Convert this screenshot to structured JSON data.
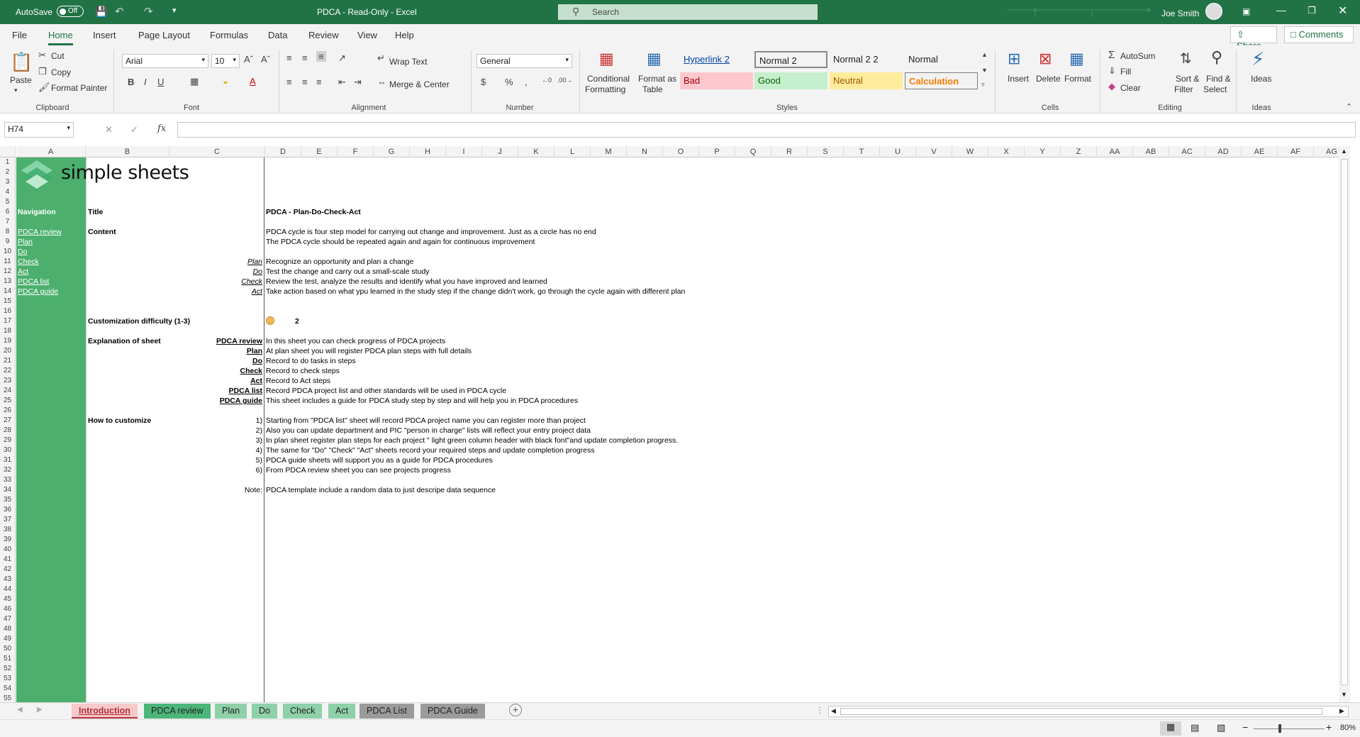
{
  "titlebar": {
    "autosave": "AutoSave",
    "toggle": "Off",
    "title": "PDCA  -  Read-Only  -  Excel",
    "search": "Search",
    "user": "Joe Smith"
  },
  "menu": {
    "tabs": [
      "File",
      "Home",
      "Insert",
      "Page Layout",
      "Formulas",
      "Data",
      "Review",
      "View",
      "Help"
    ],
    "share": "Share",
    "comments": "Comments"
  },
  "ribbon": {
    "clipboard": {
      "paste": "Paste",
      "cut": "Cut",
      "copy": "Copy",
      "format_painter": "Format Painter",
      "group": "Clipboard"
    },
    "font": {
      "name": "Arial",
      "size": "10",
      "group": "Font"
    },
    "alignment": {
      "wrap": "Wrap Text",
      "merge": "Merge & Center",
      "group": "Alignment"
    },
    "number": {
      "format": "General",
      "group": "Number"
    },
    "styles": {
      "cond": "Conditional",
      "cond2": "Formatting",
      "fmt_table": "Format as",
      "fmt_table2": "Table",
      "cells": [
        {
          "label": "Hyperlink 2"
        },
        {
          "label": "Normal 2"
        },
        {
          "label": "Normal 2 2"
        },
        {
          "label": "Normal"
        },
        {
          "label": "Bad"
        },
        {
          "label": "Good"
        },
        {
          "label": "Neutral"
        },
        {
          "label": "Calculation"
        }
      ],
      "group": "Styles"
    },
    "cells": {
      "insert": "Insert",
      "delete": "Delete",
      "format": "Format",
      "group": "Cells"
    },
    "editing": {
      "autosum": "AutoSum",
      "fill": "Fill",
      "clear": "Clear",
      "sort": "Sort &",
      "sort2": "Filter",
      "find": "Find &",
      "find2": "Select",
      "group": "Editing"
    },
    "ideas": {
      "label": "Ideas",
      "group": "Ideas"
    }
  },
  "formula_bar": {
    "name_box": "H74",
    "fx": "fx",
    "formula": ""
  },
  "columns": [
    "A",
    "B",
    "C",
    "D",
    "E",
    "F",
    "G",
    "H",
    "I",
    "J",
    "K",
    "L",
    "M",
    "N",
    "O",
    "P",
    "Q",
    "R",
    "S",
    "T",
    "U",
    "V",
    "W",
    "X",
    "Y",
    "Z",
    "AA",
    "AB",
    "AC",
    "AD",
    "AE",
    "AF",
    "AG"
  ],
  "sheet": {
    "logo_text": "simple sheets",
    "navigation": "Navigation",
    "nav_links": [
      "PDCA review",
      "Plan",
      "Do",
      "Check",
      "Act",
      "PDCA list",
      "PDCA guide"
    ],
    "title_label": "Title",
    "title": "PDCA - Plan-Do-Check-Act",
    "content_label": "Content",
    "content_lines": [
      "PDCA cycle is four step model for carrying out change and improvement. Just as a circle has no end",
      "The PDCA cycle should be repeated again and again for continuous improvement"
    ],
    "steps": [
      {
        "key": "Plan",
        "text": "Recognize an opportunity and plan a change"
      },
      {
        "key": "Do",
        "text": "Test the change and carry out a small-scale study"
      },
      {
        "key": "Check",
        "text": "Review the test, analyze the results and identify what you have improved and learned"
      },
      {
        "key": "Act",
        "text": "Take action based on what ypu learned in the study step if the change didn't work, go through the cycle again with different plan"
      }
    ],
    "difficulty_label": "Customization difficulty (1-3)",
    "difficulty": "2",
    "difficulty_color": "#f0b95a",
    "explanation_label": "Explanation of sheet",
    "explanations": [
      {
        "key": "PDCA review",
        "text": "In this sheet you can check progress of PDCA projects"
      },
      {
        "key": "Plan",
        "text": "At plan sheet you will register PDCA plan steps with full details"
      },
      {
        "key": "Do",
        "text": "Record to do tasks in steps"
      },
      {
        "key": "Check",
        "text": "Record to check steps"
      },
      {
        "key": "Act",
        "text": "Record to Act steps"
      },
      {
        "key": "PDCA list",
        "text": "Record PDCA project list and other standards will be used in PDCA cycle"
      },
      {
        "key": "PDCA guide",
        "text": "This sheet includes a guide for PDCA study step by step and will help you in PDCA procedures"
      }
    ],
    "customize_label": "How to customize",
    "customize": [
      {
        "n": "1)",
        "text": "Starting from \"PDCA list\" sheet will record PDCA project name you can register more than project"
      },
      {
        "n": "2)",
        "text": "Also you can update department and PIC \"person in charge\" lists will reflect your entry project data"
      },
      {
        "n": "3)",
        "text": "In plan sheet register plan steps for each project \" light green column header with black font\"and update completion progress."
      },
      {
        "n": "4)",
        "text": "The same for \"Do\" \"Check\" \"Act\" sheets record your required steps and update completion progress"
      },
      {
        "n": "5)",
        "text": "PDCA guide sheets will support you as a guide for PDCA procedures"
      },
      {
        "n": "6)",
        "text": "From PDCA review sheet you can see projects progress"
      }
    ],
    "note_label": "Note:",
    "note": "PDCA template include a random data to just descripe data sequence"
  },
  "sheet_tabs": [
    {
      "label": "Introduction",
      "bg": "#f8c9c9",
      "color": "#b0303a"
    },
    {
      "label": "PDCA review",
      "bg": "#4cb57a",
      "color": "#222"
    },
    {
      "label": "Plan",
      "bg": "#8ed1a8",
      "color": "#222"
    },
    {
      "label": "Do",
      "bg": "#8ed1a8",
      "color": "#222"
    },
    {
      "label": "Check",
      "bg": "#8ed1a8",
      "color": "#222"
    },
    {
      "label": "Act",
      "bg": "#8ed1a8",
      "color": "#222"
    },
    {
      "label": "PDCA List",
      "bg": "#9b9b9b",
      "color": "#222"
    },
    {
      "label": "PDCA Guide",
      "bg": "#9b9b9b",
      "color": "#222"
    }
  ],
  "status": {
    "zoom": "80%"
  },
  "colors": {
    "excel_green": "#217346",
    "nav_green": "#4caf6e"
  }
}
